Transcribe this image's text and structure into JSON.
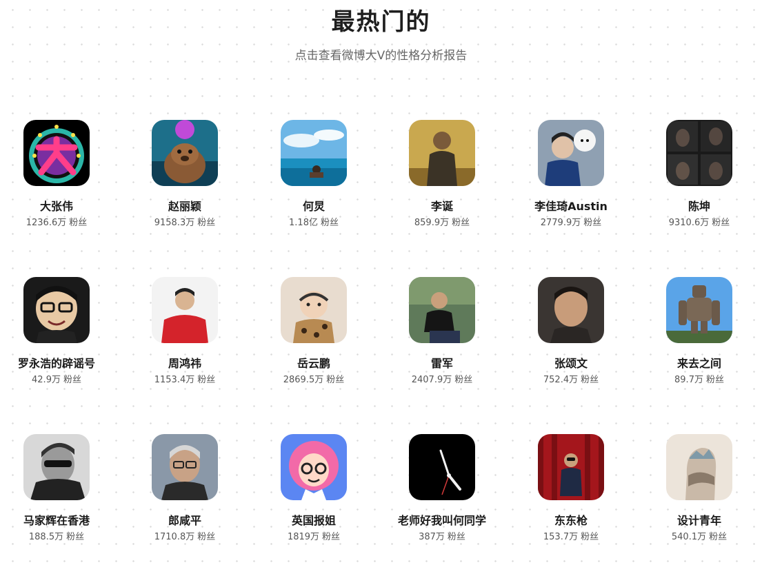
{
  "header": {
    "title": "最热门的",
    "subtitle": "点击查看微博大V的性格分析报告"
  },
  "fans_suffix": "粉丝",
  "users": [
    {
      "name": "大张伟",
      "fans": "1236.6万",
      "avatar": "big-character-logo"
    },
    {
      "name": "赵丽颖",
      "fans": "9158.3万",
      "avatar": "beaver-with-balloon"
    },
    {
      "name": "何炅",
      "fans": "1.18亿",
      "avatar": "person-in-ocean-pool"
    },
    {
      "name": "李诞",
      "fans": "859.9万",
      "avatar": "man-painting-portrait"
    },
    {
      "name": "李佳琦Austin",
      "fans": "2779.9万",
      "avatar": "man-with-white-poodle"
    },
    {
      "name": "陈坤",
      "fans": "9310.6万",
      "avatar": "dark-grid-portraits"
    },
    {
      "name": "罗永浩的辟谣号",
      "fans": "42.9万",
      "avatar": "cartoon-man-glasses"
    },
    {
      "name": "周鸿祎",
      "fans": "1153.4万",
      "avatar": "man-red-sweater"
    },
    {
      "name": "岳云鹏",
      "fans": "2869.5万",
      "avatar": "baby-leopard-print"
    },
    {
      "name": "雷军",
      "fans": "2407.9万",
      "avatar": "man-seated-tshirt"
    },
    {
      "name": "张颂文",
      "fans": "752.4万",
      "avatar": "man-closeup-portrait"
    },
    {
      "name": "来去之间",
      "fans": "89.7万",
      "avatar": "robot-statue-sky"
    },
    {
      "name": "马家辉在香港",
      "fans": "188.5万",
      "avatar": "bw-man-sunglasses"
    },
    {
      "name": "郎咸平",
      "fans": "1710.8万",
      "avatar": "man-gray-hair-glasses"
    },
    {
      "name": "英国报姐",
      "fans": "1819万",
      "avatar": "cartoon-girl-glasses"
    },
    {
      "name": "老师好我叫何同学",
      "fans": "387万",
      "avatar": "clock-hands-black"
    },
    {
      "name": "东东枪",
      "fans": "153.7万",
      "avatar": "man-red-curtain"
    },
    {
      "name": "设计青年",
      "fans": "540.1万",
      "avatar": "double-exposure-head"
    }
  ]
}
